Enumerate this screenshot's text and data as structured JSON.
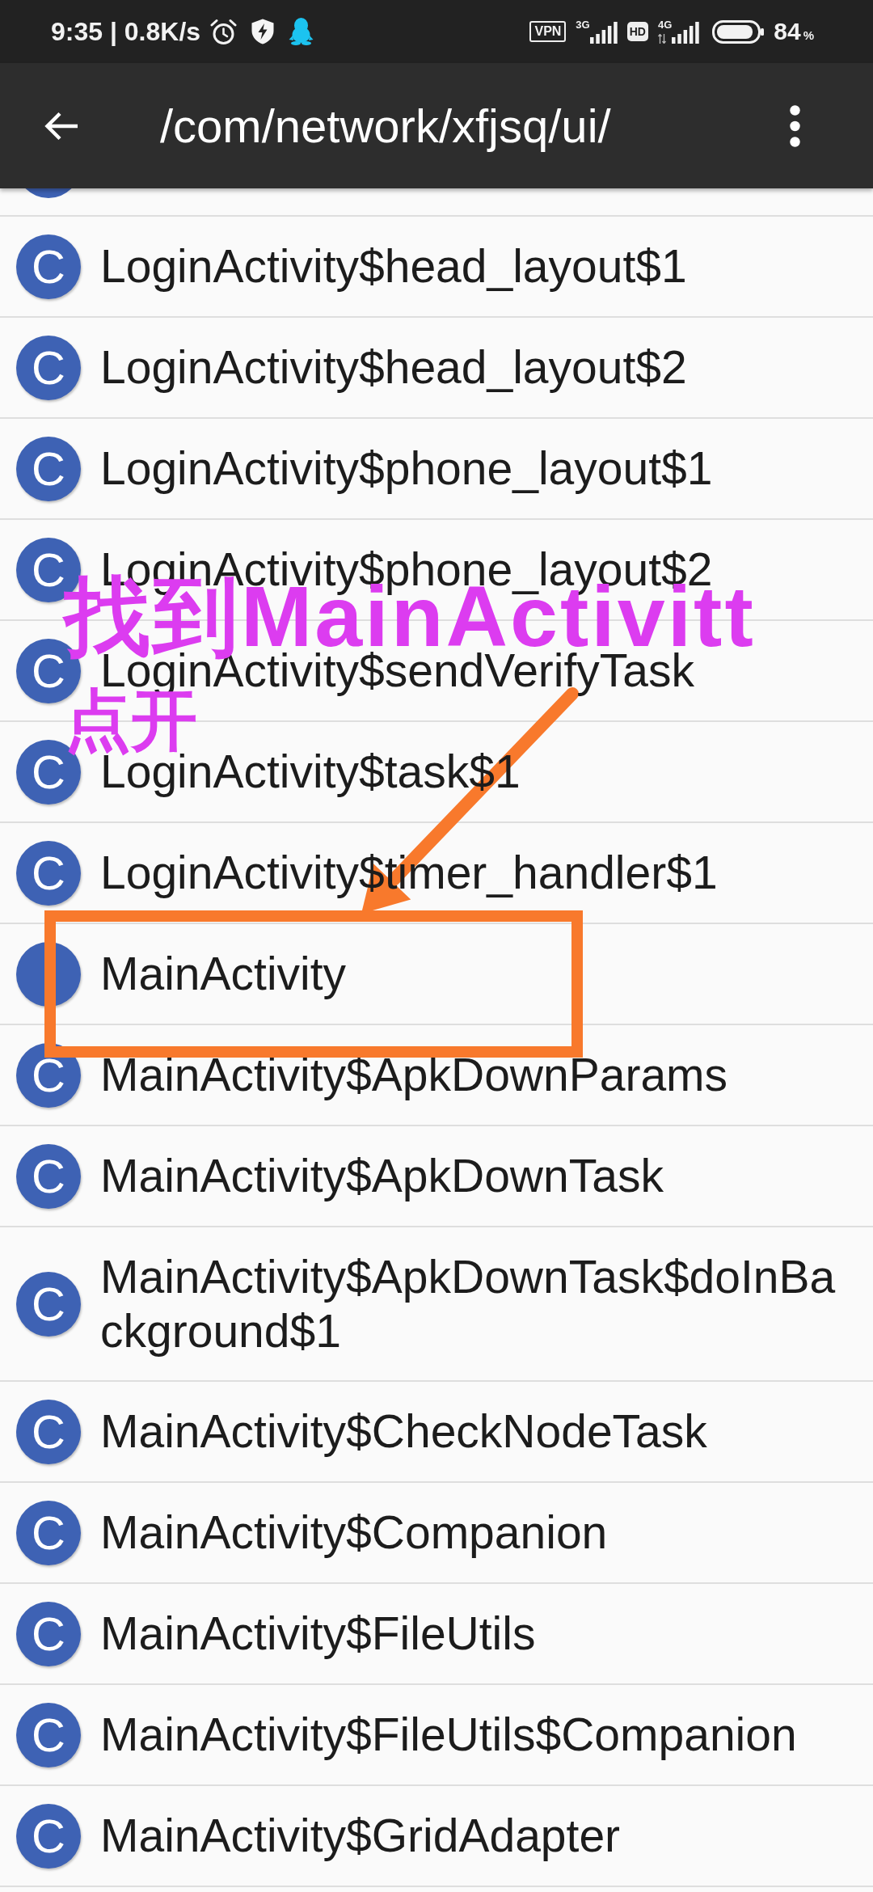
{
  "status_bar": {
    "time_speed": "9:35 | 0.8K/s",
    "vpn": "VPN",
    "sim1_network": "3G",
    "hd": "HD",
    "sim2_network": "4G",
    "battery_percent": "84",
    "percent_sign": "%"
  },
  "app_bar": {
    "title": "/com/network/xfjsq/ui/"
  },
  "files": [
    {
      "icon_letter": "C",
      "name": "LoginActivity$head_layout$1",
      "highlighted": false
    },
    {
      "icon_letter": "C",
      "name": "LoginActivity$head_layout$2",
      "highlighted": false
    },
    {
      "icon_letter": "C",
      "name": "LoginActivity$phone_layout$1",
      "highlighted": false
    },
    {
      "icon_letter": "C",
      "name": "LoginActivity$phone_layout$2",
      "highlighted": false
    },
    {
      "icon_letter": "C",
      "name": "LoginActivity$sendVerifyTask",
      "highlighted": false
    },
    {
      "icon_letter": "C",
      "name": "LoginActivity$task$1",
      "highlighted": false
    },
    {
      "icon_letter": "C",
      "name": "LoginActivity$timer_handler$1",
      "highlighted": false
    },
    {
      "name": "MainActivity",
      "highlighted": true
    },
    {
      "icon_letter": "C",
      "name": "MainActivity$ApkDownParams",
      "highlighted": false
    },
    {
      "icon_letter": "C",
      "name": "MainActivity$ApkDownTask",
      "highlighted": false
    },
    {
      "icon_letter": "C",
      "name": "MainActivity$ApkDownTask$doInBackground$1",
      "highlighted": false
    },
    {
      "icon_letter": "C",
      "name": "MainActivity$CheckNodeTask",
      "highlighted": false
    },
    {
      "icon_letter": "C",
      "name": "MainActivity$Companion",
      "highlighted": false
    },
    {
      "icon_letter": "C",
      "name": "MainActivity$FileUtils",
      "highlighted": false
    },
    {
      "icon_letter": "C",
      "name": "MainActivity$FileUtils$Companion",
      "highlighted": false
    },
    {
      "icon_letter": "C",
      "name": "MainActivity$GridAdapter",
      "highlighted": false
    }
  ],
  "annotation": {
    "lines": [
      "找到MainActivitt",
      "点开"
    ]
  }
}
